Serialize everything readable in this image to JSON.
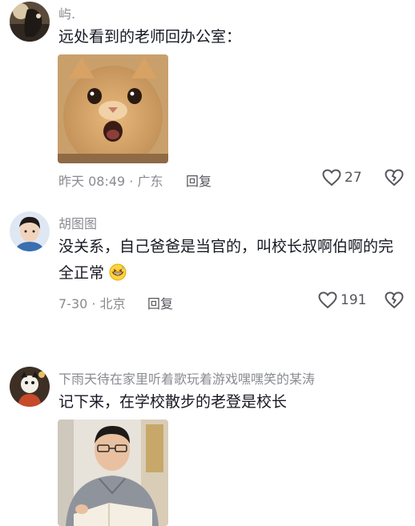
{
  "comments": [
    {
      "username": "屿.",
      "text": "远处看到的老师回办公室：",
      "time": "昨天 08:49 · 广东",
      "reply": "回复",
      "likes": "27",
      "image": "cat-surprised-photo"
    },
    {
      "username": "胡图图",
      "text": "没关系，自己爸爸是当官的，叫校长叔啊伯啊的完全正常",
      "emoji": "grinning-sweat-emoji",
      "time": "7-30 · 北京",
      "reply": "回复",
      "likes": "191"
    },
    {
      "username": "下雨天待在家里听着歌玩着游戏嘿嘿笑的某涛",
      "text": "记下来，在学校散步的老登是校长",
      "image": "man-reading-book-photo"
    }
  ],
  "icons": {
    "like": "heart-outline-icon",
    "dislike": "broken-heart-icon"
  }
}
